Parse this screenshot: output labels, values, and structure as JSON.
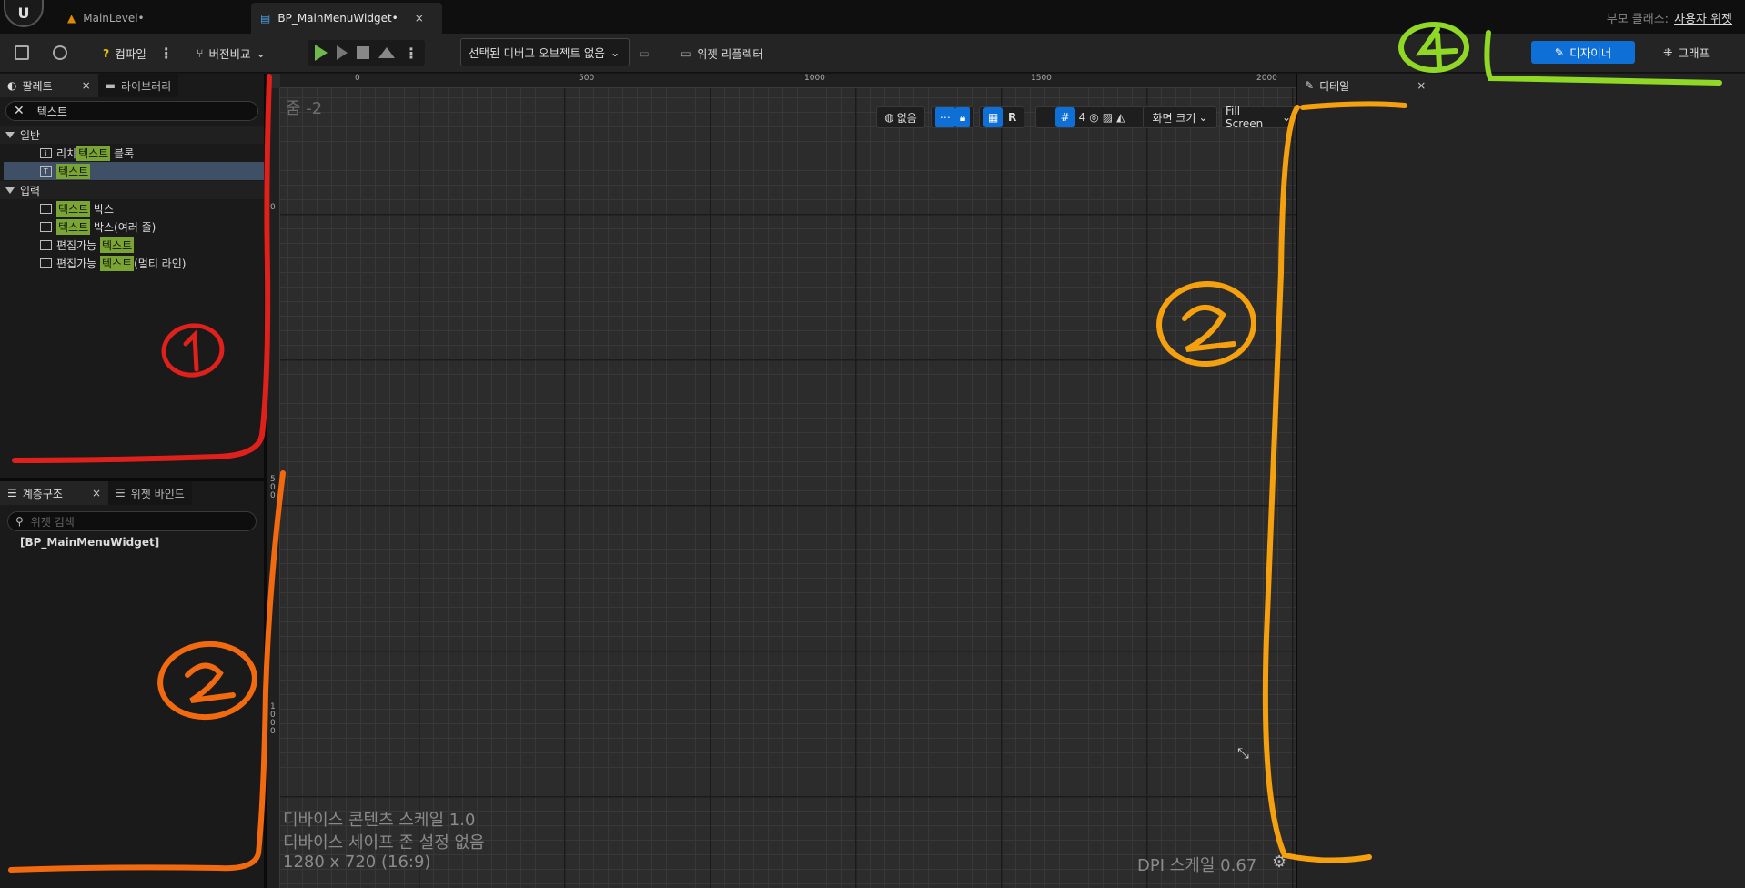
{
  "titlebar": {
    "tabs": [
      {
        "label": "MainLevel•",
        "icon": "level-icon",
        "close": ""
      },
      {
        "label": "BP_MainMenuWidget•",
        "icon": "widget-blueprint-icon",
        "close": "×"
      }
    ],
    "parent_class_label": "부모 클래스:",
    "parent_class_value": "사용자 위젯"
  },
  "toolbar": {
    "compile_label": "컴파일",
    "diff_label": "버전비교",
    "debug_object": "선택된 디버그 오브젝트 없음",
    "widget_reflector": "위젯 리플렉터",
    "designer_label": "디자이너",
    "graph_label": "그래프"
  },
  "palette": {
    "tab_label": "팔레트",
    "library_tab_label": "라이브러리",
    "close": "×",
    "search_value": "텍스트",
    "categories": [
      {
        "name": "일반",
        "items": [
          {
            "pre": "리치 ",
            "hl": "텍스트",
            "post": " 블록"
          },
          {
            "pre": "",
            "hl": "텍스트",
            "post": ""
          }
        ]
      },
      {
        "name": "입력",
        "items": [
          {
            "pre": "",
            "hl": "텍스트",
            "post": " 박스"
          },
          {
            "pre": "",
            "hl": "텍스트",
            "post": " 박스(여러 줄)"
          },
          {
            "pre": "편집가능 ",
            "hl": "텍스트",
            "post": ""
          },
          {
            "pre": "편집가능 ",
            "hl": "텍스트",
            "post": "(멀티 라인)"
          }
        ]
      }
    ]
  },
  "hierarchy": {
    "tab_label": "계층구조",
    "binding_tab_label": "위젯 바인드",
    "close": "×",
    "search_placeholder": "위젯 검색",
    "root": "[BP_MainMenuWidget]"
  },
  "viewport": {
    "zoom": "줌 -2",
    "ruler_top": [
      "0",
      "500",
      "1000",
      "1500",
      "2000"
    ],
    "ruler_left": [
      "0",
      "500",
      "1000"
    ],
    "btn_none": "없음",
    "btn_r": "R",
    "grid_count": "4",
    "screen_size": "화면 크기",
    "fill_screen": "Fill Screen",
    "info_lines": [
      "디바이스 콘텐츠 스케일 1.0",
      "디바이스 세이프 존 설정 없음",
      "1280 x 720 (16:9)"
    ],
    "dpi": "DPI 스케일 0.67"
  },
  "details": {
    "tab_label": "디테일",
    "close": "×"
  },
  "annotations": {
    "colors": {
      "red": "#e0201a",
      "orange_left": "#f26a0f",
      "orange_right": "#f5a00f",
      "green": "#8fd826"
    },
    "labels": [
      "1",
      "2",
      "2",
      "4"
    ]
  }
}
